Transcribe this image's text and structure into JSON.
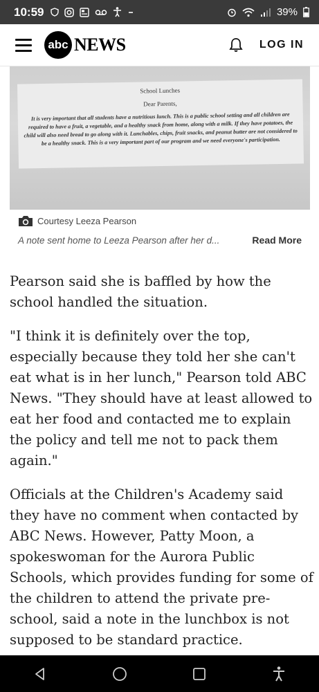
{
  "status_bar": {
    "time": "10:59",
    "battery": "39%",
    "icons": [
      "shield-icon",
      "instagram-icon",
      "news-icon",
      "voicemail-icon",
      "accessibility-icon",
      "minus-icon",
      "alarm-icon",
      "wifi-icon",
      "signal-icon",
      "battery-icon"
    ]
  },
  "header": {
    "logo_circle": "abc",
    "logo_text": "NEWS",
    "login_label": "LOG IN"
  },
  "photo": {
    "note_title": "School Lunches",
    "note_greeting": "Dear Parents,",
    "note_body": "It is very important that all students have a nutritious lunch. This is a public school setting and all children are required to have a fruit, a vegetable, and a healthy snack from home, along with a milk. If they have potatoes, the child will also need bread to go along with it. Lunchables, chips, fruit snacks, and peanut butter are not considered to be a healthy snack. This is a very important part of our program and we need everyone's participation.",
    "credit": "Courtesy Leeza Pearson",
    "caption": "A note sent home to Leeza Pearson after her d...",
    "read_more": "Read More"
  },
  "article": {
    "paragraphs": [
      "Pearson said she is baffled by how the school handled the situation.",
      "\"I think it is definitely over the top, especially because they told her she can't eat what is in her lunch,\" Pearson told ABC News. \"They should have at least allowed to eat her food and contacted me to explain the policy and tell me not to pack them again.\"",
      "Officials at the Children's Academy said they have no comment when contacted by ABC News. However, Patty Moon, a spokeswoman for the Aurora Public Schools, which provides funding for some of the children to attend the private pre-school, said a note in the lunchbox is not supposed to be standard practice."
    ]
  },
  "nav_bar": {
    "buttons": [
      "back-icon",
      "home-icon",
      "recents-icon",
      "accessibility-icon"
    ]
  }
}
